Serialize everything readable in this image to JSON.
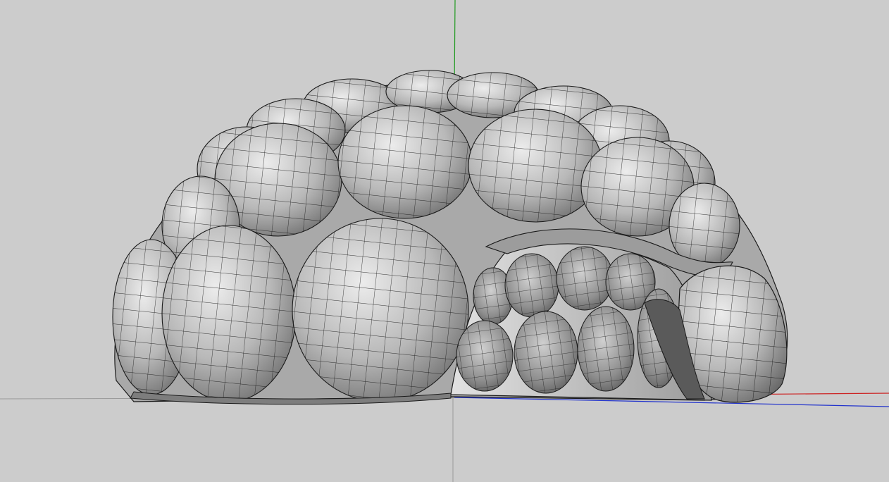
{
  "viewport": {
    "background": "#cccccc",
    "projection": "perspective",
    "render_style": "shaded-with-edges"
  },
  "axes": {
    "x_color": "#cc2222",
    "y_color": "#1f9a1f",
    "z_color": "#2233cc",
    "ground_line_color": "#9a9a9a"
  },
  "model": {
    "object": "lumpy-dome-shell",
    "face_fill": "#a9a9a9",
    "edge_color": "#1a1a1a"
  }
}
